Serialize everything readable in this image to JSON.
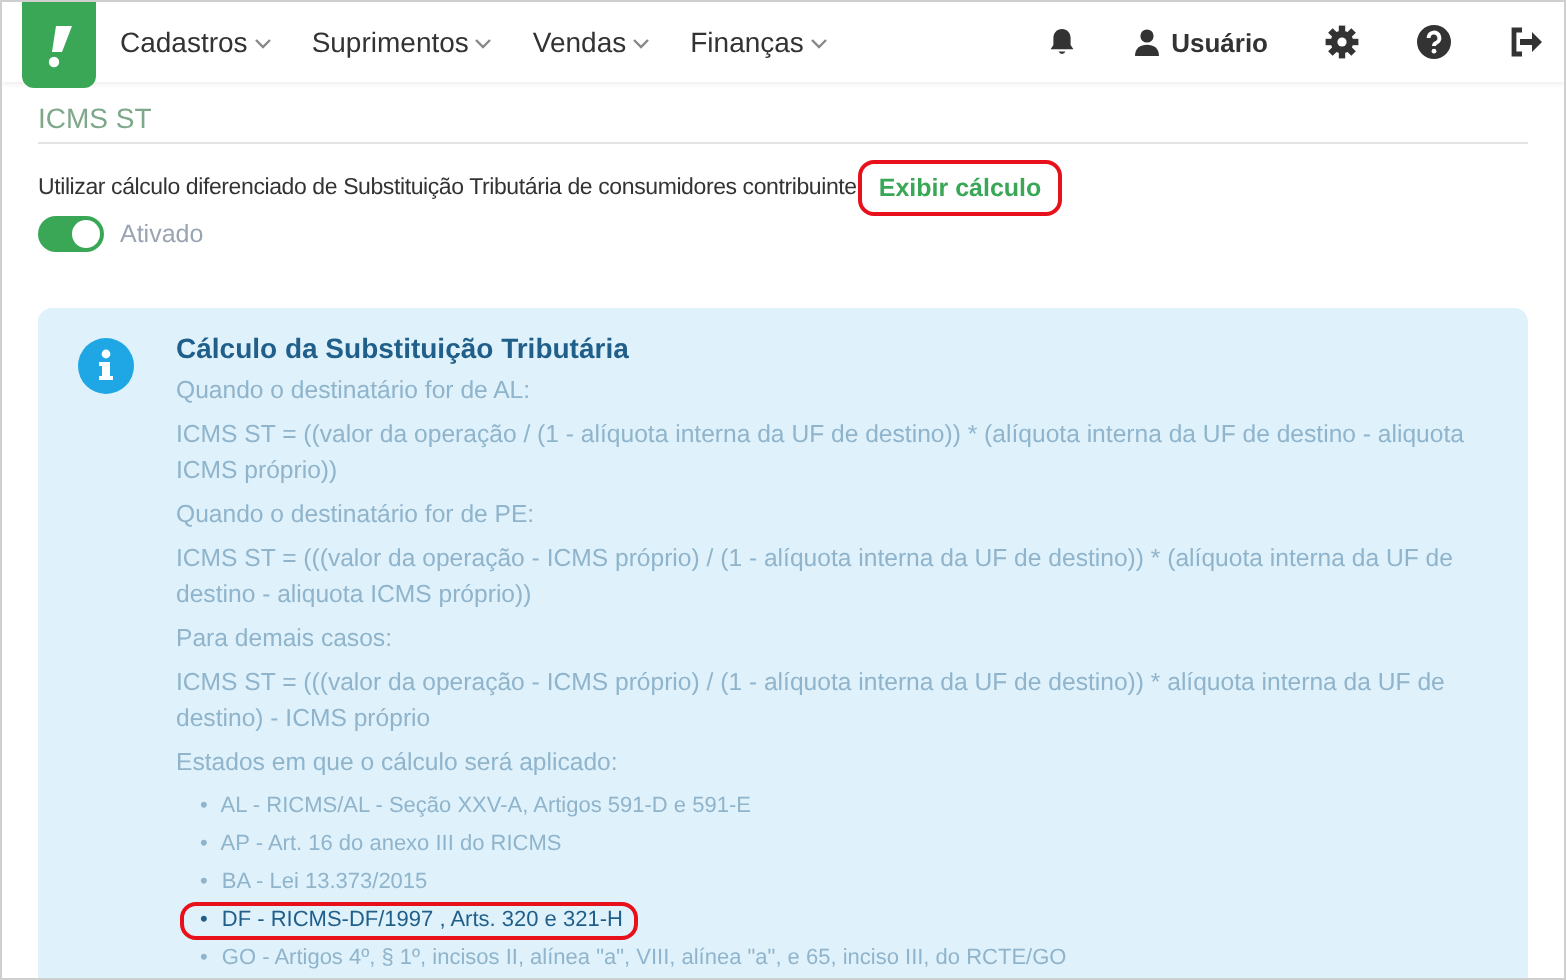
{
  "nav": {
    "menus": [
      {
        "label": "Cadastros"
      },
      {
        "label": "Suprimentos"
      },
      {
        "label": "Vendas"
      },
      {
        "label": "Finanças"
      }
    ],
    "user": "Usuário"
  },
  "section": {
    "title": "ICMS ST",
    "option_label": "Utilizar cálculo diferenciado de Substituição Tributária de consumidores contribuinte",
    "link": {
      "label": "Exibir cálculo",
      "highlighted": true
    },
    "toggle": {
      "on": true,
      "label": "Ativado"
    }
  },
  "info": {
    "title": "Cálculo da Substituição Tributária",
    "paragraphs": [
      {
        "text": "Quando o destinatário for de AL:",
        "highlighted": false
      },
      {
        "text": "ICMS ST = ((valor da operação / (1 - alíquota interna da UF de destino)) * (alíquota interna da UF de destino - aliquota ICMS próprio))",
        "highlighted": false
      },
      {
        "text": "Quando o destinatário for de PE:",
        "highlighted": false
      },
      {
        "text": "ICMS ST = (((valor da operação - ICMS próprio) / (1 - alíquota interna da UF de destino)) * (alíquota interna da UF de destino - aliquota ICMS próprio))",
        "highlighted": false
      },
      {
        "text": "Para demais casos:",
        "highlighted": false
      },
      {
        "text": "ICMS ST = (((valor da operação - ICMS próprio) / (1 - alíquota interna da UF de destino)) * alíquota interna da UF de destino) - ICMS próprio",
        "highlighted": false
      },
      {
        "text": "Estados em que o cálculo será aplicado:",
        "highlighted": false
      }
    ],
    "states": [
      {
        "marker": "•",
        "text": "AL - RICMS/AL - Seção XXV-A, Artigos 591-D e 591-E",
        "highlighted": false
      },
      {
        "marker": "•",
        "text": "AP - Art. 16 do anexo III do RICMS",
        "highlighted": false
      },
      {
        "marker": "•",
        "text": "BA - Lei 13.373/2015",
        "highlighted": false
      },
      {
        "marker": "•",
        "text": "DF - RICMS-DF/1997 , Arts. 320 e 321-H",
        "highlighted": true
      },
      {
        "marker": "•",
        "text": "GO - Artigos 4º, § 1º, incisos II, alínea \"a\", VIII, alínea \"a\", e 65, inciso III, do RCTE/GO",
        "highlighted": false
      }
    ]
  }
}
